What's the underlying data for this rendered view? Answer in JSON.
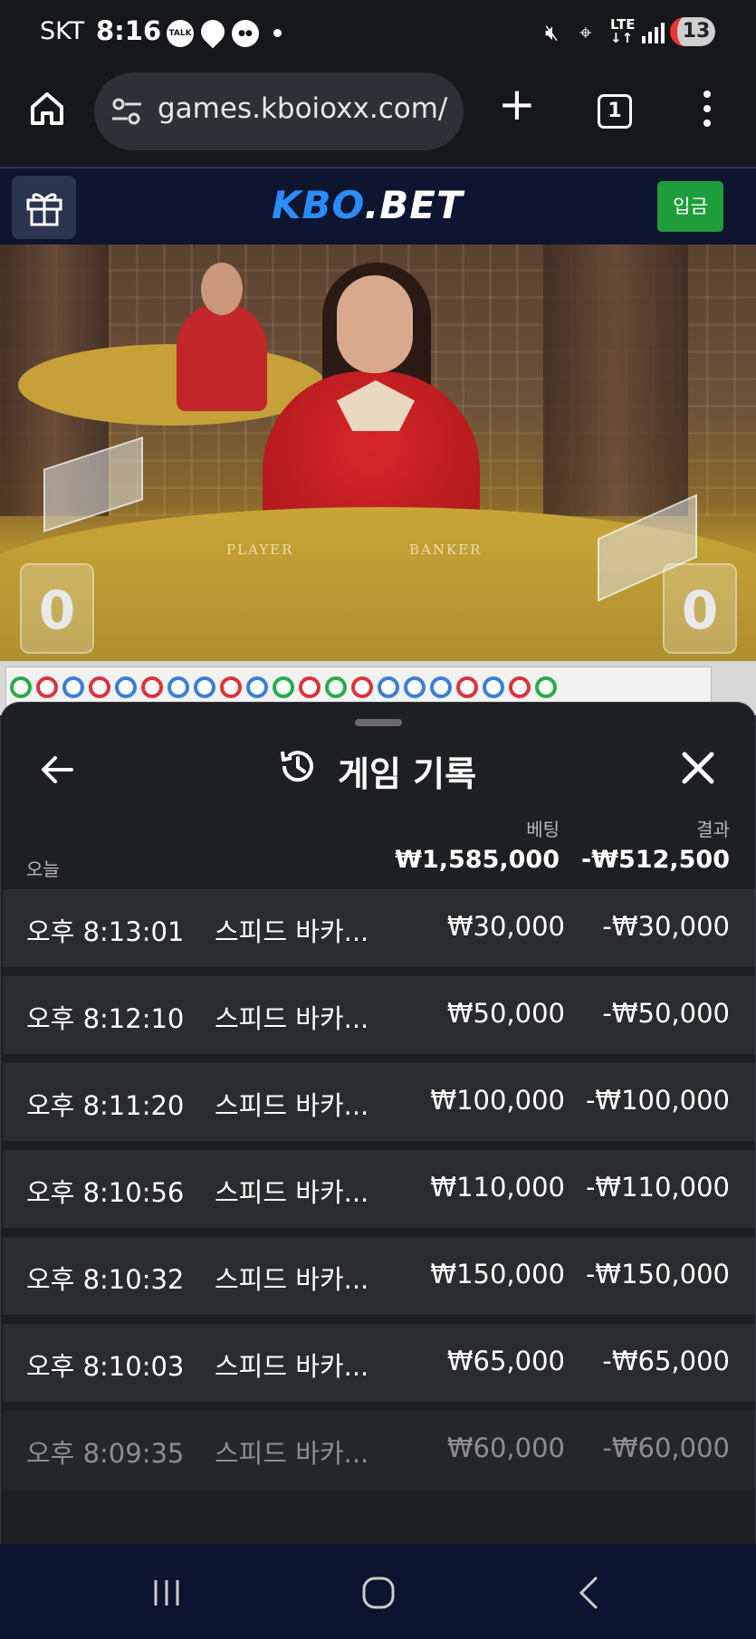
{
  "status_bar": {
    "carrier": "SKT",
    "time": "8:16",
    "app_icons": [
      "talk-icon",
      "location-pin-icon",
      "chat-bubble-icon"
    ],
    "network": "LTE",
    "battery": "13"
  },
  "browser": {
    "url": "games.kboioxx.com/",
    "tab_count": "1"
  },
  "site_header": {
    "logo_part1": "KBO",
    "logo_part2": ".BET",
    "deposit_label": "입금"
  },
  "video": {
    "player_label": "PLAYER",
    "banker_label": "BANKER",
    "player_score": "0",
    "banker_score": "0"
  },
  "history_sheet": {
    "title": "게임 기록",
    "bet_column": "베팅",
    "result_column": "결과",
    "summary_label": "오늘",
    "summary_bet": "₩1,585,000",
    "summary_result": "-₩512,500",
    "rows": [
      {
        "time": "오후 8:13:01",
        "game": "스피드 바카...",
        "bet": "₩30,000",
        "result": "-₩30,000"
      },
      {
        "time": "오후 8:12:10",
        "game": "스피드 바카...",
        "bet": "₩50,000",
        "result": "-₩50,000"
      },
      {
        "time": "오후 8:11:20",
        "game": "스피드 바카...",
        "bet": "₩100,000",
        "result": "-₩100,000"
      },
      {
        "time": "오후 8:10:56",
        "game": "스피드 바카...",
        "bet": "₩110,000",
        "result": "-₩110,000"
      },
      {
        "time": "오후 8:10:32",
        "game": "스피드 바카...",
        "bet": "₩150,000",
        "result": "-₩150,000"
      },
      {
        "time": "오후 8:10:03",
        "game": "스피드 바카...",
        "bet": "₩65,000",
        "result": "-₩65,000"
      },
      {
        "time": "오후 8:09:35",
        "game": "스피드 바카...",
        "bet": "₩60,000",
        "result": "-₩60,000"
      }
    ]
  },
  "colors": {
    "accent_blue": "#2b8cff",
    "deposit_green": "#1f9d3a",
    "sheet_bg": "#1e1f23",
    "row_bg": "#2a2b2f"
  }
}
